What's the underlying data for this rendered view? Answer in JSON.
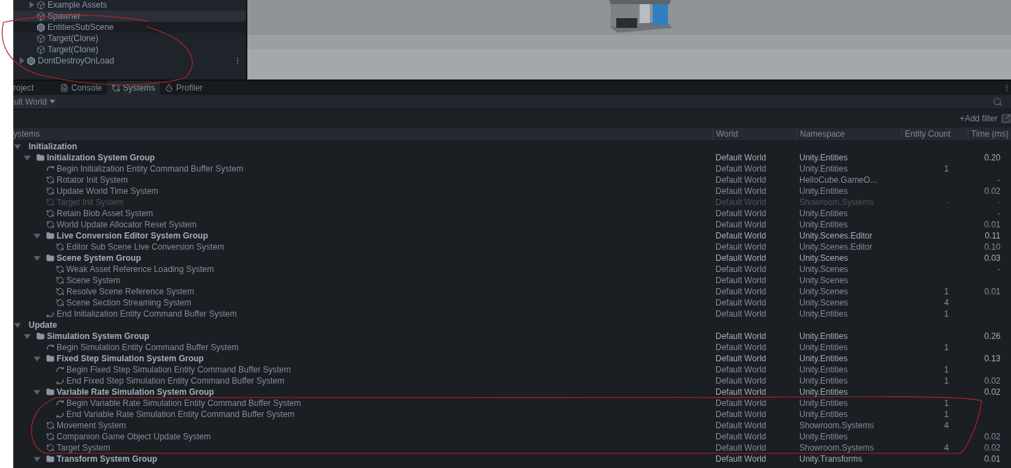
{
  "hierarchy": {
    "scene_children": [
      {
        "name": "Example Assets",
        "kind": "gameobject",
        "expanded": false,
        "selected": false
      },
      {
        "name": "Spawner",
        "kind": "gameobject",
        "selected": true
      },
      {
        "name": "EntitiesSubScene",
        "kind": "subscene",
        "selected": false
      },
      {
        "name": "Target(Clone)",
        "kind": "gameobject",
        "selected": false
      },
      {
        "name": "Target(Clone)",
        "kind": "gameobject",
        "selected": false
      }
    ],
    "root_scenes": [
      {
        "name": "DontDestroyOnLoad",
        "kind": "subscene",
        "expanded": false,
        "selected": false
      }
    ]
  },
  "tabs": [
    {
      "label": "roject",
      "kind": "plain",
      "selected": false
    },
    {
      "label": "Console",
      "kind": "console",
      "selected": false
    },
    {
      "label": "Systems",
      "kind": "systems",
      "selected": true
    },
    {
      "label": "Profiler",
      "kind": "profiler",
      "selected": false
    }
  ],
  "world_dropdown": "ult World",
  "add_filter": "+Add filter",
  "columns": [
    "ystems",
    "World",
    "Namespace",
    "Entity Count",
    "Time (ms)"
  ],
  "rows": [
    {
      "name": "Initialization",
      "kind": "category",
      "expanded": true,
      "enabled": true,
      "children": [
        {
          "name": "Initialization System Group",
          "kind": "group",
          "expanded": true,
          "enabled": true,
          "world": "Default World",
          "namespace": "Unity.Entities",
          "time": "0.20",
          "children": [
            {
              "name": "Begin Initialization Entity Command Buffer System",
              "kind": "begin_buffer",
              "enabled": true,
              "world": "Default World",
              "namespace": "Unity.Entities",
              "count": "1"
            },
            {
              "name": "Rotator Init System",
              "kind": "system",
              "enabled": true,
              "world": "Default World",
              "namespace": "HelloCube.GameO...",
              "time": "-"
            },
            {
              "name": "Update World Time System",
              "kind": "system",
              "enabled": true,
              "world": "Default World",
              "namespace": "Unity.Entities",
              "time": "0.02"
            },
            {
              "name": "Target Init System",
              "kind": "system",
              "enabled": false,
              "world": "Default World",
              "namespace": "Showroom.Systems",
              "count": "-",
              "time": "-"
            },
            {
              "name": "Retain Blob Asset System",
              "kind": "system",
              "enabled": true,
              "world": "Default World",
              "namespace": "Unity.Entities",
              "time": "-"
            },
            {
              "name": "World Update Allocator Reset System",
              "kind": "system",
              "enabled": true,
              "world": "Default World",
              "namespace": "Unity.Entities",
              "time": "0.01"
            },
            {
              "name": "Live Conversion Editor System Group",
              "kind": "group",
              "expanded": true,
              "enabled": true,
              "world": "Default World",
              "namespace": "Unity.Scenes.Editor",
              "time": "0.11",
              "children": [
                {
                  "name": "Editor Sub Scene Live Conversion System",
                  "kind": "system",
                  "enabled": true,
                  "world": "Default World",
                  "namespace": "Unity.Scenes.Editor",
                  "time": "0.10"
                }
              ]
            },
            {
              "name": "Scene System Group",
              "kind": "group",
              "expanded": true,
              "enabled": true,
              "world": "Default World",
              "namespace": "Unity.Scenes",
              "time": "0.03",
              "children": [
                {
                  "name": "Weak Asset Reference Loading System",
                  "kind": "system",
                  "enabled": true,
                  "world": "Default World",
                  "namespace": "Unity.Scenes",
                  "time": "-"
                },
                {
                  "name": "Scene System",
                  "kind": "system",
                  "enabled": true,
                  "world": "Default World",
                  "namespace": "Unity.Scenes"
                },
                {
                  "name": "Resolve Scene Reference System",
                  "kind": "system",
                  "enabled": true,
                  "world": "Default World",
                  "namespace": "Unity.Scenes",
                  "count": "1",
                  "time": "0.01"
                },
                {
                  "name": "Scene Section Streaming System",
                  "kind": "system",
                  "enabled": true,
                  "world": "Default World",
                  "namespace": "Unity.Scenes",
                  "count": "4"
                }
              ]
            },
            {
              "name": "End Initialization Entity Command Buffer System",
              "kind": "end_buffer",
              "enabled": true,
              "world": "Default World",
              "namespace": "Unity.Entities",
              "count": "1"
            }
          ]
        }
      ]
    },
    {
      "name": "Update",
      "kind": "category",
      "expanded": true,
      "enabled": true,
      "children": [
        {
          "name": "Simulation System Group",
          "kind": "group",
          "expanded": true,
          "enabled": true,
          "world": "Default World",
          "namespace": "Unity.Entities",
          "time": "0.26",
          "children": [
            {
              "name": "Begin Simulation Entity Command Buffer System",
              "kind": "begin_buffer",
              "enabled": true,
              "world": "Default World",
              "namespace": "Unity.Entities",
              "count": "1"
            },
            {
              "name": "Fixed Step Simulation System Group",
              "kind": "group",
              "expanded": true,
              "enabled": true,
              "world": "Default World",
              "namespace": "Unity.Entities",
              "time": "0.13",
              "children": [
                {
                  "name": "Begin Fixed Step Simulation Entity Command Buffer System",
                  "kind": "begin_buffer",
                  "enabled": true,
                  "world": "Default World",
                  "namespace": "Unity.Entities",
                  "count": "1"
                },
                {
                  "name": "End Fixed Step Simulation Entity Command Buffer System",
                  "kind": "end_buffer",
                  "enabled": true,
                  "world": "Default World",
                  "namespace": "Unity.Entities",
                  "count": "1",
                  "time": "0.02"
                }
              ]
            },
            {
              "name": "Variable Rate Simulation System Group",
              "kind": "group",
              "expanded": true,
              "enabled": true,
              "world": "Default World",
              "namespace": "Unity.Entities",
              "time": "0.02",
              "children": [
                {
                  "name": "Begin Variable Rate Simulation Entity Command Buffer System",
                  "kind": "begin_buffer",
                  "enabled": true,
                  "world": "Default World",
                  "namespace": "Unity.Entities",
                  "count": "1"
                },
                {
                  "name": "End Variable Rate Simulation Entity Command Buffer System",
                  "kind": "end_buffer",
                  "enabled": true,
                  "world": "Default World",
                  "namespace": "Unity.Entities",
                  "count": "1"
                }
              ]
            },
            {
              "name": "Movement System",
              "kind": "system",
              "enabled": true,
              "world": "Default World",
              "namespace": "Showroom.Systems",
              "count": "4"
            },
            {
              "name": "Companion Game Object Update System",
              "kind": "system",
              "enabled": true,
              "world": "Default World",
              "namespace": "Unity.Entities",
              "time": "0.02"
            },
            {
              "name": "Target System",
              "kind": "system",
              "enabled": true,
              "world": "Default World",
              "namespace": "Showroom.Systems",
              "count": "4",
              "time": "0.02"
            },
            {
              "name": "Transform System Group",
              "kind": "group",
              "expanded": true,
              "enabled": true,
              "world": "Default World",
              "namespace": "Unity.Transforms",
              "time": "0.01"
            }
          ]
        }
      ]
    }
  ]
}
